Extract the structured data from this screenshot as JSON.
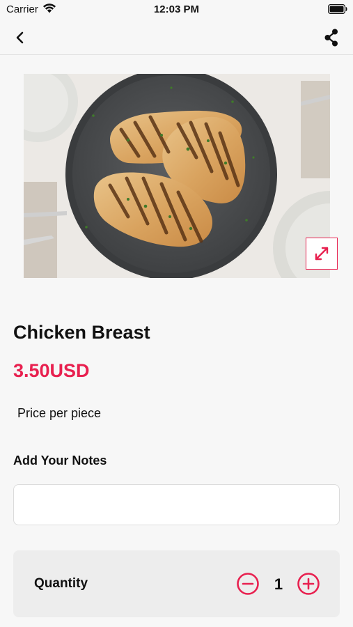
{
  "status_bar": {
    "carrier": "Carrier",
    "time": "12:03 PM"
  },
  "nav": {
    "back_icon": "chevron-left-icon",
    "share_icon": "share-icon"
  },
  "product": {
    "image_alt": "Grilled chicken breast on a dark plate",
    "title": "Chicken Breast",
    "price": "3.50USD",
    "price_note": "Price per piece",
    "expand_icon": "expand-icon"
  },
  "notes": {
    "label": "Add Your Notes",
    "value": "",
    "placeholder": ""
  },
  "quantity": {
    "label": "Quantity",
    "value": "1",
    "minus_icon": "minus-circle-icon",
    "plus_icon": "plus-circle-icon"
  },
  "colors": {
    "accent": "#e8204f",
    "background": "#f7f7f7",
    "card": "#ededed"
  }
}
